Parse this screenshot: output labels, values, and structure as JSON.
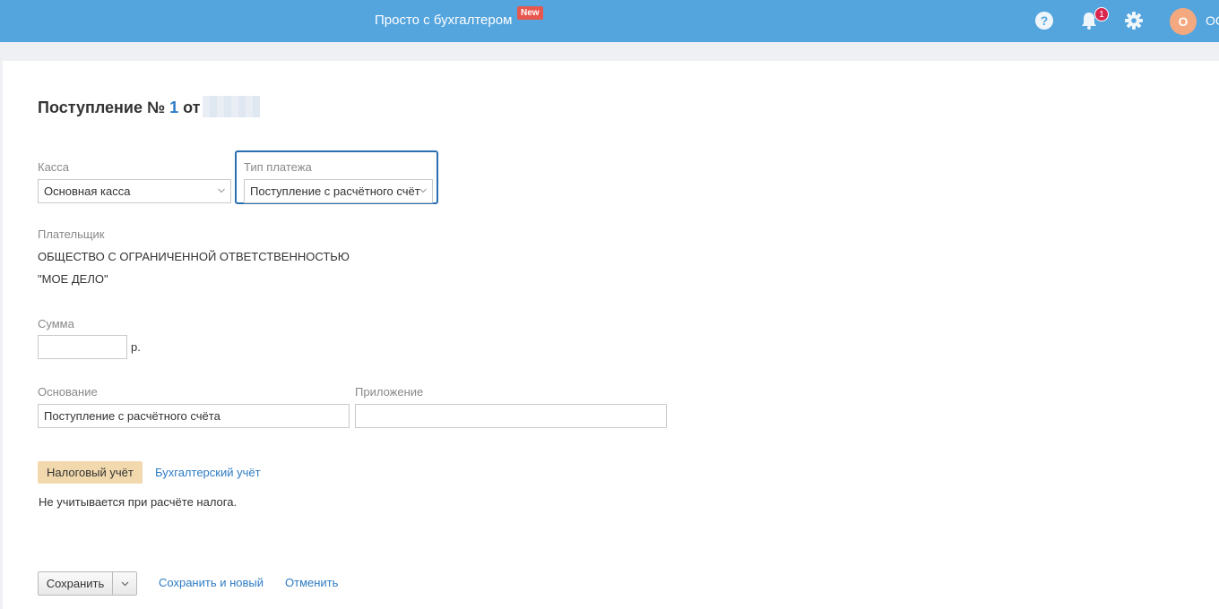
{
  "header": {
    "brand_link": "Просто с бухгалтером",
    "new_badge": "New",
    "notification_count": "1",
    "avatar_letter": "О",
    "org_name_visible": "ОС",
    "icons": [
      "help-icon",
      "bell-icon",
      "gear-icon"
    ],
    "colors": {
      "bar": "#54a4de",
      "badge": "#e6574e",
      "notif": "#d8264f",
      "avatar": "#f4a87f"
    }
  },
  "form": {
    "title_prefix": "Поступление №",
    "number": "1",
    "title_from": "от",
    "kassa": {
      "label": "Касса",
      "value": "Основная касса"
    },
    "payment_type": {
      "label": "Тип платежа",
      "value": "Поступление с расчётного счёт"
    },
    "payer": {
      "label": "Плательщик",
      "line1": "ОБЩЕСТВО С ОГРАНИЧЕННОЙ ОТВЕТСТВЕННОСТЬЮ",
      "line2": "\"МОЕ ДЕЛО\""
    },
    "sum": {
      "label": "Сумма",
      "value": "",
      "unit": "р."
    },
    "basis": {
      "label": "Основание",
      "value": "Поступление с расчётного счёта"
    },
    "attachment": {
      "label": "Приложение",
      "value": ""
    },
    "tabs": {
      "tax": "Налоговый учёт",
      "accounting": "Бухгалтерский учёт"
    },
    "tax_note": "Не учитывается при расчёте налога."
  },
  "actions": {
    "save": "Сохранить",
    "save_and_new": "Сохранить и новый",
    "cancel": "Отменить"
  }
}
